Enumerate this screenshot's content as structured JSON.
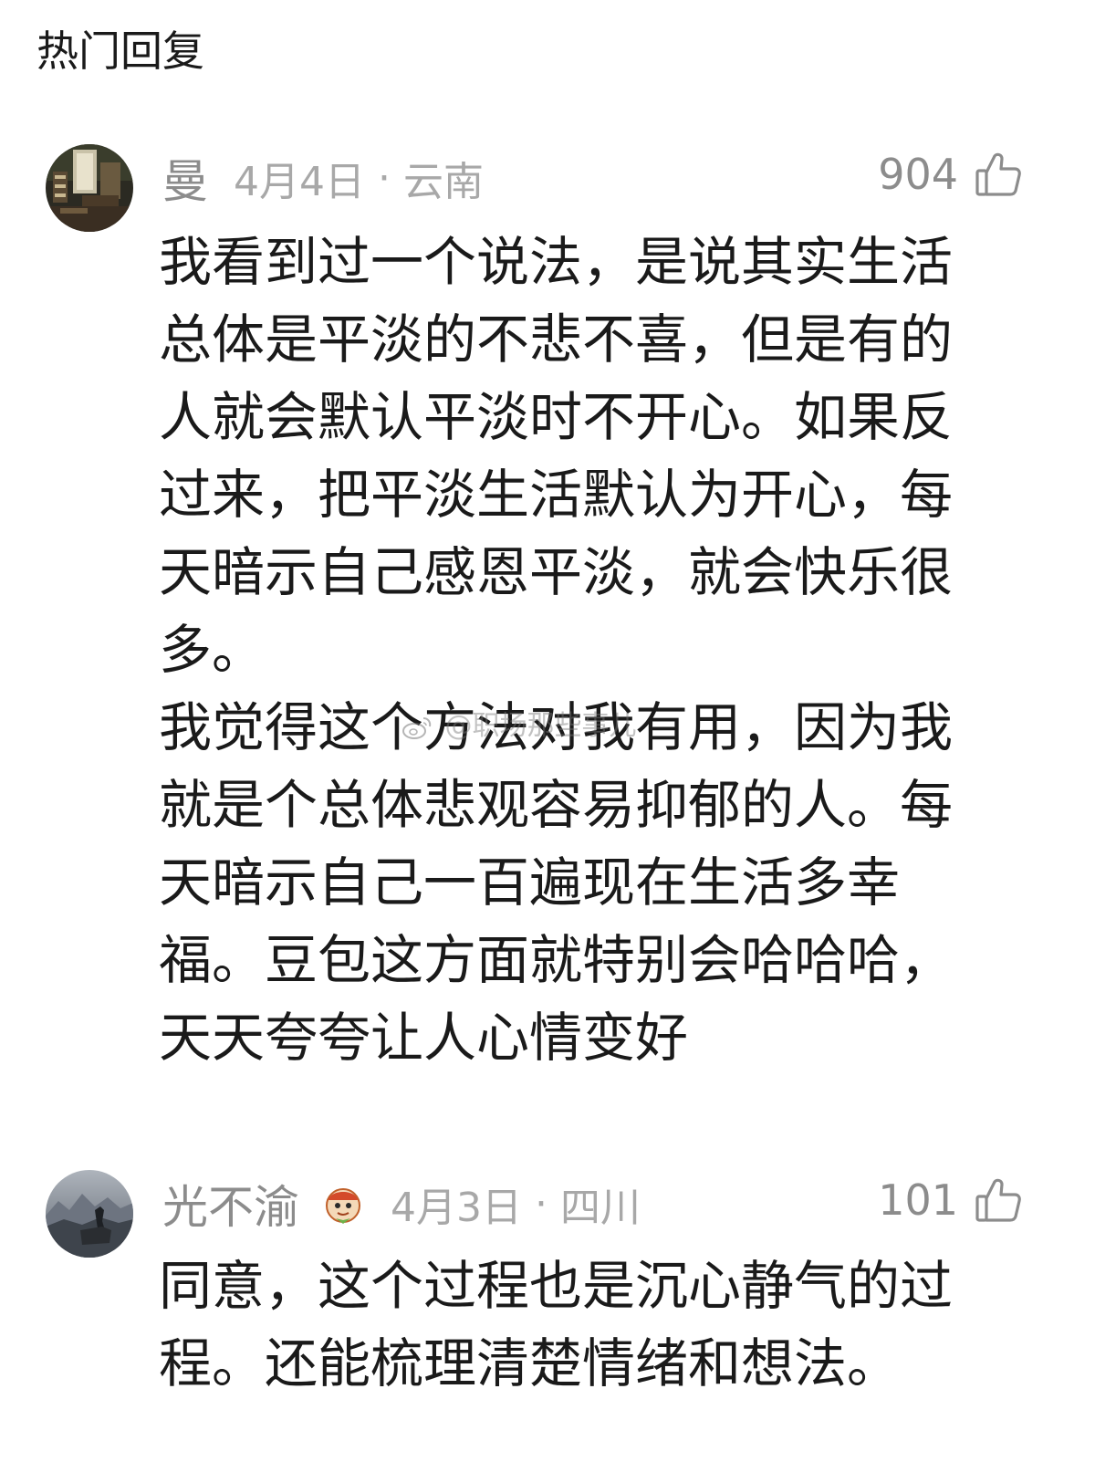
{
  "section": {
    "title": "热门回复"
  },
  "comments": [
    {
      "username": "曼",
      "date": "4月4日",
      "separator": "·",
      "location": "云南",
      "likes": "904",
      "text": "我看到过一个说法，是说其实生活\n总体是平淡的不悲不喜，但是有的\n人就会默认平淡时不开心。如果反\n过来，把平淡生活默认为开心，每\n天暗示自己感恩平淡，就会快乐很\n多。\n我觉得这个方法对我有用，因为我\n就是个总体悲观容易抑郁的人。每\n天暗示自己一百遍现在生活多幸\n福。豆包这方面就特别会哈哈哈，\n天天夸夸让人心情变好"
    },
    {
      "username": "光不渝",
      "date": "4月3日",
      "separator": "·",
      "location": "四川",
      "likes": "101",
      "text": "同意，这个过程也是沉心静气的过\n程。还能梳理清楚情绪和想法。"
    }
  ],
  "watermark": {
    "text": "@职场那些事儿"
  },
  "icons": {
    "like": "thumbs-up-icon",
    "badge": "mascot-badge-icon",
    "watermark_logo": "weibo-logo-icon"
  },
  "colors": {
    "text_primary": "#1a1a1a",
    "text_meta": "#a8a8a8",
    "username": "#8c8c8c"
  }
}
